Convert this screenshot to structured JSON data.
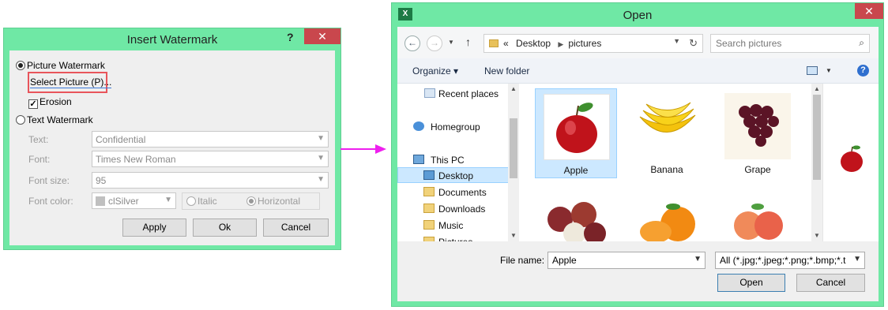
{
  "watermark_dialog": {
    "title": "Insert Watermark",
    "help": "?",
    "close": "✕",
    "picture_watermark_label": "Picture Watermark",
    "select_picture_label": "Select Picture (P)...",
    "erosion_label": "Erosion",
    "text_watermark_label": "Text Watermark",
    "text_label": "Text:",
    "text_value": "Confidential",
    "font_label": "Font:",
    "font_value": "Times New Roman",
    "font_size_label": "Font size:",
    "font_size_value": "95",
    "font_color_label": "Font color:",
    "font_color_value": "clSilver",
    "italic_label": "Italic",
    "horizontal_label": "Horizontal",
    "apply_label": "Apply",
    "ok_label": "Ok",
    "cancel_label": "Cancel"
  },
  "open_dialog": {
    "title": "Open",
    "app_icon": "X",
    "close": "✕",
    "back": "←",
    "forward": "→",
    "up": "↑",
    "breadcrumb": {
      "prefix": "«",
      "items": [
        "Desktop",
        "pictures"
      ]
    },
    "search_placeholder": "Search pictures",
    "organize_label": "Organize ▾",
    "new_folder_label": "New folder",
    "nav_items": [
      "Recent places",
      "Homegroup",
      "This PC",
      "Desktop",
      "Documents",
      "Downloads",
      "Music",
      "Pictures"
    ],
    "files": [
      "Apple",
      "Banana",
      "Grape"
    ],
    "file_name_label": "File name:",
    "file_name_value": "Apple",
    "file_type_value": "All (*.jpg;*.jpeg;*.png;*.bmp;*.t",
    "open_label": "Open",
    "cancel_label": "Cancel"
  },
  "colors": {
    "dialog_frame": "#6fe8a5",
    "close_button": "#c9474d",
    "highlight": "#e8555b",
    "arrow": "#ee1fee",
    "selection": "#cce8ff"
  }
}
